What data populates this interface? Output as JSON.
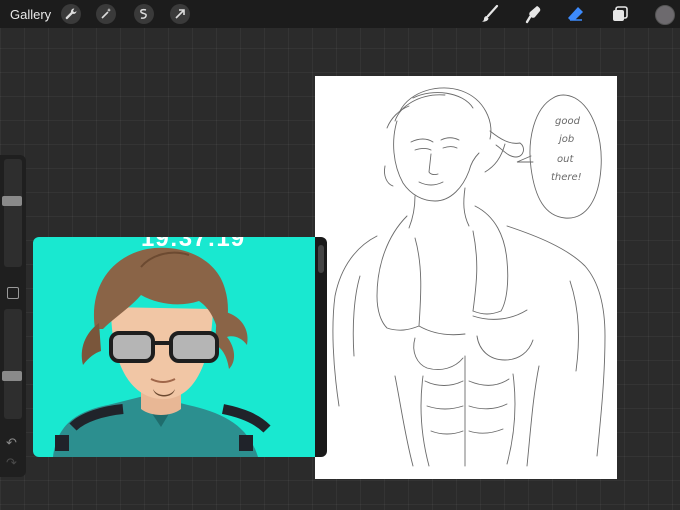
{
  "topbar": {
    "gallery_label": "Gallery",
    "left_tools": [
      "wrench-icon",
      "magic-wand-icon",
      "selection-icon",
      "transform-arrow-icon"
    ],
    "right_tools": [
      "brush-icon",
      "smudge-icon",
      "eraser-icon",
      "layers-icon",
      "color-icon"
    ]
  },
  "colors": {
    "active_tool": "#3d8bfd",
    "current_color": "#6d6a6e",
    "reference_background": "#19e8d0"
  },
  "sidebar": {
    "brush_size_level": 0.62,
    "opacity_level": 0.38
  },
  "reference": {
    "clock_text": "19:37:19"
  },
  "canvas": {
    "speech_bubble_lines": [
      "good",
      "job",
      "out",
      "there!"
    ]
  }
}
